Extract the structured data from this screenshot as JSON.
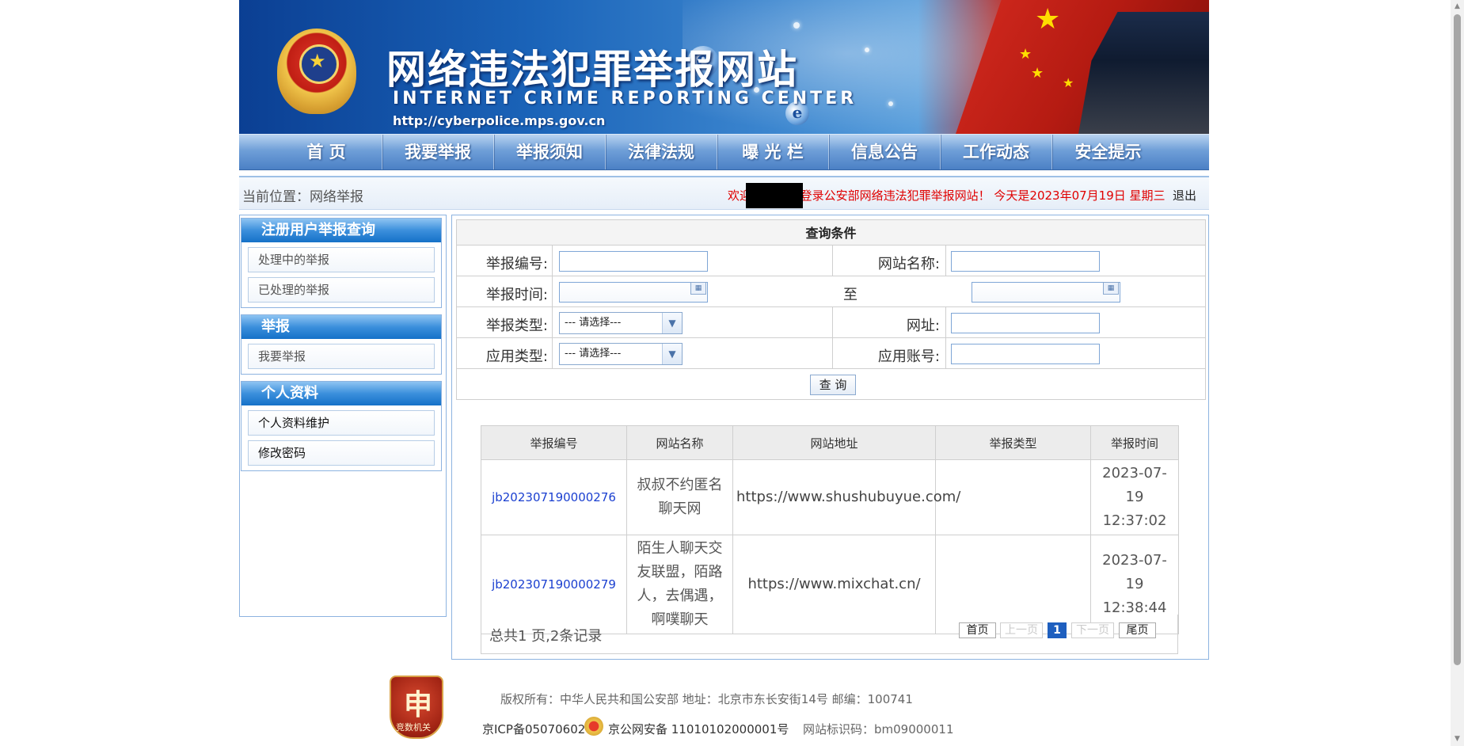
{
  "header": {
    "title": "网络违法犯罪举报网站",
    "subtitle": "INTERNET CRIME REPORTING CENTER",
    "url": "http://cyberpolice.mps.gov.cn"
  },
  "nav": [
    "首 页",
    "我要举报",
    "举报须知",
    "法律法规",
    "曝 光 栏",
    "信息公告",
    "工作动态",
    "安全提示"
  ],
  "location": {
    "label": "当前位置：网络举报",
    "welcome": "欢迎XXXXXX登录公安部网络违法犯罪举报网站！ 今天是2023年07月19日 星期三",
    "logout": "退出"
  },
  "sidebar": {
    "sections": [
      {
        "title": "注册用户举报查询",
        "items": [
          "处理中的举报",
          "已处理的举报"
        ]
      },
      {
        "title": "举报",
        "items": [
          "我要举报"
        ]
      },
      {
        "title": "个人资料",
        "items": [
          "个人资料维护",
          "修改密码"
        ]
      }
    ]
  },
  "query": {
    "title": "查询条件",
    "report_no_label": "举报编号:",
    "site_name_label": "网站名称:",
    "report_time_label": "举报时间:",
    "to_label": "至",
    "report_type_label": "举报类型:",
    "url_label": "网址:",
    "app_type_label": "应用类型:",
    "app_account_label": "应用账号:",
    "select_placeholder": "--- 请选择---",
    "report_no_value": "",
    "site_name_value": "",
    "time_from_value": "",
    "time_to_value": "",
    "url_value": "",
    "app_account_value": "",
    "search_button": "查 询"
  },
  "results": {
    "columns": [
      "举报编号",
      "网站名称",
      "网站地址",
      "举报类型",
      "举报时间"
    ],
    "rows": [
      {
        "id": "jb202307190000276",
        "site_name": "叔叔不约匿名聊天网",
        "url": "https://www.shushubuyue.com/",
        "type": "",
        "time": "2023-07-19 12:37:02"
      },
      {
        "id": "jb202307190000279",
        "site_name": "陌生人聊天交友联盟，陌路人，去偶遇，啊噗聊天",
        "url": "https://www.mixchat.cn/",
        "type": "",
        "time": "2023-07-19 12:38:44"
      }
    ],
    "summary": "总共1 页,2条记录",
    "pager": {
      "first": "首页",
      "prev": "上一页",
      "current": "1",
      "next": "下一页",
      "last": "尾页"
    }
  },
  "footer": {
    "badge_text": "竞数机关",
    "line1": "版权所有：中华人民共和国公安部    地址：北京市东长安街14号    邮编：100741",
    "icp": "京ICP备05070602号",
    "gongan": "京公网安备 11010102000001号",
    "site_code": "网站标识码：bm09000011"
  }
}
